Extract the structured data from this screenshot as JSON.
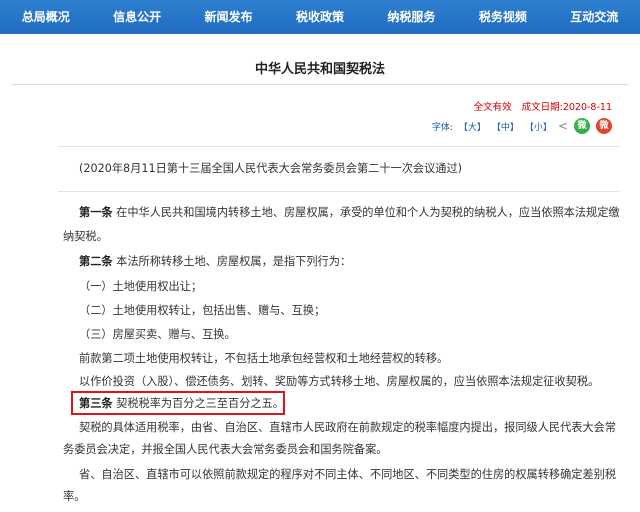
{
  "nav": {
    "items": [
      "总局概况",
      "信息公开",
      "新闻发布",
      "税收政策",
      "纳税服务",
      "税务视频",
      "互动交流"
    ]
  },
  "article": {
    "title": "中华人民共和国契税法",
    "status": "全文有效",
    "date": "成文日期:2020-8-11",
    "font_label": "字体:",
    "font_large": "【大】",
    "font_medium": "【中】",
    "font_small": "【小】",
    "wechat_glyph": "微",
    "weibo_glyph": "微",
    "share_glyph": "<"
  },
  "body": {
    "adoption_note": "(2020年8月11日第十三届全国人民代表大会常务委员会第二十一次会议通过)",
    "art1_label": "第一条",
    "art1_line1": "在中华人民共和国境内转移土地、房屋权属，承受的单位和个人为契税的纳税人，应当依照本法规定缴",
    "art1_line2": "纳契税。",
    "art2_label": "第二条",
    "art2_text": "本法所称转移土地、房屋权属，是指下列行为：",
    "item1": "（一）土地使用权出让；",
    "item2": "（二）土地使用权转让，包括出售、赠与、互换；",
    "item3": "（三）房屋买卖、赠与、互换。",
    "art2_para2": "前款第二项土地使用权转让，不包括土地承包经营权和土地经营权的转移。",
    "art2_para3": "以作价投资（入股）、偿还债务、划转、奖励等方式转移土地、房屋权属的，应当依照本法规定征收契税。",
    "art3_label": "第三条",
    "art3_text": "契税税率为百分之三至百分之五。",
    "art3_para2_line1": "契税的具体适用税率，由省、自治区、直辖市人民政府在前款规定的税率幅度内提出，报同级人民代表大会常",
    "art3_para2_line2": "务委员会决定，并报全国人民代表大会常务委员会和国务院备案。",
    "art3_para3_line1": "省、自治区、直辖市可以依照前款规定的程序对不同主体、不同地区、不同类型的住房的权属转移确定差别税",
    "art3_para3_line2": "率。"
  },
  "colors": {
    "nav_bg": "#1f6cc0",
    "accent_red": "#d40000",
    "highlight_border": "#e0151b"
  }
}
